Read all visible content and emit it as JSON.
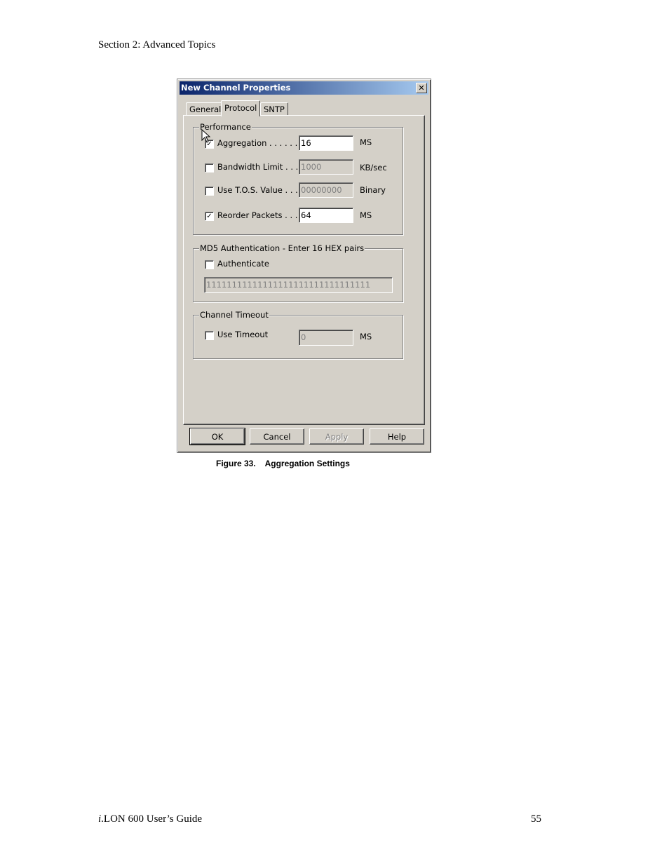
{
  "header": {
    "section": "Section 2: Advanced Topics"
  },
  "footer": {
    "guide_prefix": "i",
    "guide_rest": ".LON 600 User’s Guide",
    "page_number": "55"
  },
  "caption": {
    "number": "Figure 33.",
    "text": "Aggregation Settings"
  },
  "dialog": {
    "title": "New Channel Properties",
    "close_glyph": "✕",
    "tabs": [
      "General",
      "Protocol",
      "SNTP"
    ],
    "active_tab": "Protocol",
    "performance": {
      "title": "Performance",
      "aggregation": {
        "label": "Aggregation . . . . . . .",
        "checked": true,
        "value": "16",
        "unit": "MS"
      },
      "bandwidth": {
        "label": "Bandwidth Limit . . . .",
        "checked": false,
        "value": "1000",
        "unit": "KB/sec"
      },
      "tos": {
        "label": "Use T.O.S. Value . . .",
        "checked": false,
        "value": "00000000",
        "unit": "Binary"
      },
      "reorder": {
        "label": "Reorder Packets . . .",
        "checked": true,
        "value": "64",
        "unit": "MS"
      }
    },
    "md5": {
      "title": "MD5 Authentication - Enter 16 HEX pairs",
      "authenticate": {
        "label": "Authenticate",
        "checked": false
      },
      "key_value": "11111111111111111111111111111111"
    },
    "timeout": {
      "title": "Channel Timeout",
      "use_timeout": {
        "label": "Use Timeout",
        "checked": false,
        "value": "0",
        "unit": "MS"
      }
    },
    "buttons": {
      "ok": "OK",
      "cancel": "Cancel",
      "apply": "Apply",
      "help": "Help"
    },
    "check_glyph": "✓"
  }
}
